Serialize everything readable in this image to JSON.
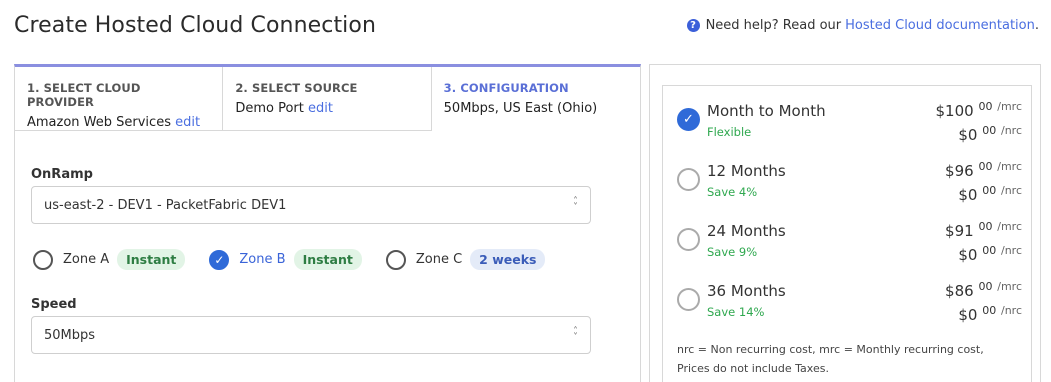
{
  "header": {
    "title": "Create Hosted Cloud Connection",
    "help_text": "Need help? Read our",
    "help_link": "Hosted Cloud documentation",
    "help_suffix": "."
  },
  "steps": [
    {
      "label": "1. SELECT CLOUD PROVIDER",
      "value": "Amazon Web Services",
      "edit": "edit"
    },
    {
      "label": "2. SELECT SOURCE",
      "value": "Demo Port",
      "edit": "edit"
    },
    {
      "label": "3. CONFIGURATION",
      "value": "50Mbps, US East (Ohio)"
    }
  ],
  "onramp": {
    "label": "OnRamp",
    "value": "us-east-2 - DEV1 - PacketFabric DEV1"
  },
  "zones": [
    {
      "label": "Zone A",
      "badge": "Instant",
      "checked": false
    },
    {
      "label": "Zone B",
      "badge": "Instant",
      "checked": true
    },
    {
      "label": "Zone C",
      "badge": "2 weeks",
      "checked": false
    }
  ],
  "speed": {
    "label": "Speed",
    "value": "50Mbps"
  },
  "pricing": {
    "options": [
      {
        "name": "Month to Month",
        "sub": "Flexible",
        "checked": true,
        "mrc_main": "$100",
        "mrc_cents": "00",
        "mrc_unit": "/mrc",
        "nrc_main": "$0",
        "nrc_cents": "00",
        "nrc_unit": "/nrc"
      },
      {
        "name": "12 Months",
        "sub": "Save 4%",
        "checked": false,
        "mrc_main": "$96",
        "mrc_cents": "00",
        "mrc_unit": "/mrc",
        "nrc_main": "$0",
        "nrc_cents": "00",
        "nrc_unit": "/nrc"
      },
      {
        "name": "24 Months",
        "sub": "Save 9%",
        "checked": false,
        "mrc_main": "$91",
        "mrc_cents": "00",
        "mrc_unit": "/mrc",
        "nrc_main": "$0",
        "nrc_cents": "00",
        "nrc_unit": "/nrc"
      },
      {
        "name": "36 Months",
        "sub": "Save 14%",
        "checked": false,
        "mrc_main": "$86",
        "mrc_cents": "00",
        "mrc_unit": "/mrc",
        "nrc_main": "$0",
        "nrc_cents": "00",
        "nrc_unit": "/nrc"
      }
    ],
    "note_line1": "nrc = Non recurring cost, mrc = Monthly recurring cost,",
    "note_line2": "Prices do not include Taxes."
  },
  "colors": {
    "accent": "#2f6ad8",
    "link": "#4a6ee0",
    "save_green": "#2fa84f",
    "tab_border": "#8a8fe0"
  }
}
